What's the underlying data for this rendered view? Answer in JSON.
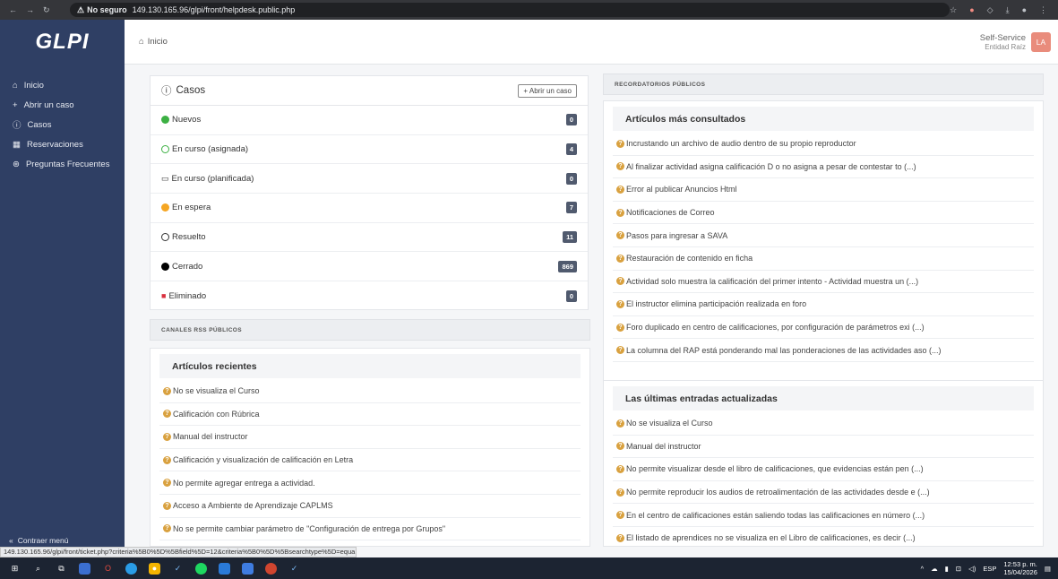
{
  "browser": {
    "insecure_label": "No seguro",
    "url": "149.130.165.96/glpi/front/helpdesk.public.php"
  },
  "sidebar": {
    "logo": "GLPI",
    "items": [
      {
        "label": "Inicio",
        "icon": "home-icon"
      },
      {
        "label": "Abrir un caso",
        "icon": "plus-icon"
      },
      {
        "label": "Casos",
        "icon": "alert-circle-icon"
      },
      {
        "label": "Reservaciones",
        "icon": "calendar-icon"
      },
      {
        "label": "Preguntas Frecuentes",
        "icon": "question-icon"
      }
    ],
    "collapse_label": "Contraer menú"
  },
  "header": {
    "breadcrumb": "Inicio",
    "profile_name": "Self-Service",
    "profile_entity": "Entidad Raíz",
    "avatar_initials": "LA"
  },
  "casos": {
    "title": "Casos",
    "open_button": "+ Abrir un caso",
    "statuses": [
      {
        "label": "Nuevos",
        "count": "0",
        "icon": "green-dot-icon",
        "color": "#3cb043"
      },
      {
        "label": "En curso (asignada)",
        "count": "4",
        "icon": "green-circle-outline-icon",
        "color": "#3cb043"
      },
      {
        "label": "En curso (planificada)",
        "count": "0",
        "icon": "calendar-icon",
        "color": "#333333"
      },
      {
        "label": "En espera",
        "count": "7",
        "icon": "orange-dot-icon",
        "color": "#f5a623"
      },
      {
        "label": "Resuelto",
        "count": "11",
        "icon": "circle-outline-icon",
        "color": "#333333"
      },
      {
        "label": "Cerrado",
        "count": "869",
        "icon": "black-dot-icon",
        "color": "#000000"
      },
      {
        "label": "Eliminado",
        "count": "0",
        "icon": "trash-icon",
        "color": "#d9303e"
      }
    ]
  },
  "rss": {
    "header": "CANALES RSS PÚBLICOS"
  },
  "recientes": {
    "title": "Artículos recientes",
    "items": [
      "No se visualiza el Curso",
      "Calificación con Rúbrica",
      "Manual del instructor",
      "Calificación y visualización de calificación en Letra",
      "No permite agregar entrega a actividad.",
      "Acceso a Ambiente de Aprendizaje CAPLMS",
      "No se permite cambiar parámetro de \"Configuración de entrega por Grupos\""
    ]
  },
  "recordatorios": {
    "header": "RECORDATORIOS PÚBLICOS"
  },
  "consultados": {
    "title": "Artículos más consultados",
    "items": [
      "Incrustando un archivo de audio dentro de su propio reproductor",
      "Al finalizar actividad asigna calificación D o no asigna a pesar de contestar to (...)",
      "Error al publicar Anuncios Html",
      "Notificaciones de Correo",
      "Pasos para ingresar a SAVA",
      "Restauración de contenido en ficha",
      "Actividad solo muestra la calificación del primer intento - Actividad muestra un (...)",
      "El instructor elimina participación realizada en foro",
      "Foro duplicado en centro de calificaciones, por configuración de parámetros exi (...)",
      " La columna del RAP está ponderando mal las ponderaciones de las actividades aso (...)"
    ]
  },
  "actualizadas": {
    "title": "Las últimas entradas actualizadas",
    "items": [
      "No se visualiza el Curso",
      "Manual del instructor",
      "No permite visualizar desde el libro de calificaciones, que evidencias están pen (...)",
      "No permite reproducir los audios de retroalimentación de las actividades desde e (...)",
      "En el centro de calificaciones están saliendo todas las calificaciones en número (...)",
      "El listado de aprendices no se visualiza en el Libro de calificaciones, es decir (...)"
    ]
  },
  "status_url": "149.130.165.96/glpi/front/ticket.php?criteria%5B0%5D%5Bfield%5D=12&criteria%5B0%5D%5Bsearchtype%5D=equa...",
  "taskbar": {
    "language": "ESP",
    "time": "12:53 p. m.",
    "date": "15/04/2026"
  }
}
